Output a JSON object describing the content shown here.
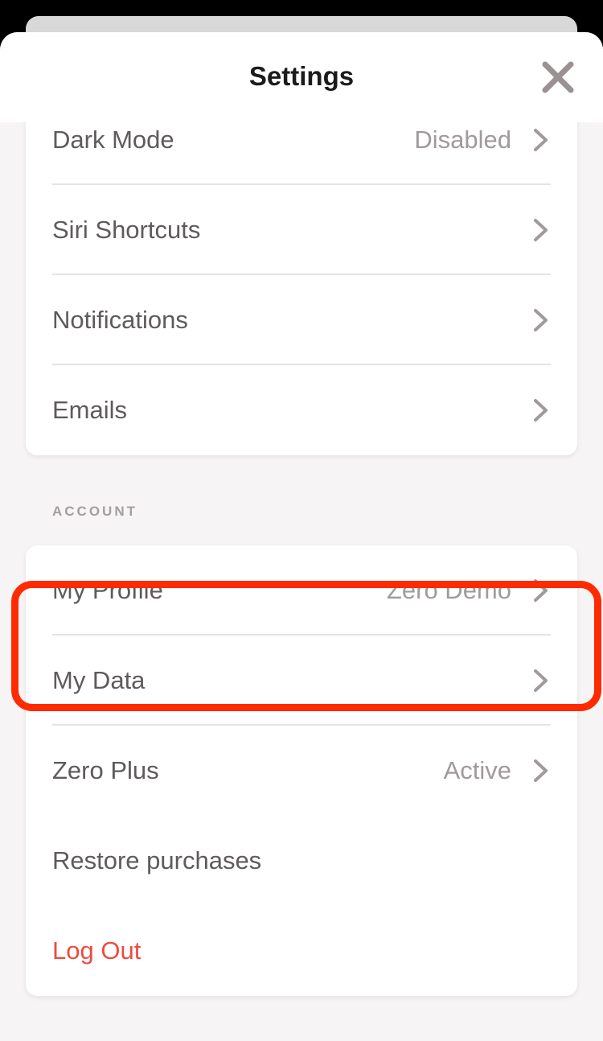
{
  "header": {
    "title": "Settings",
    "close_icon": "close-icon"
  },
  "preferences": {
    "items": [
      {
        "label": "Dark Mode",
        "value": "Disabled"
      },
      {
        "label": "Siri Shortcuts",
        "value": ""
      },
      {
        "label": "Notifications",
        "value": ""
      },
      {
        "label": "Emails",
        "value": ""
      }
    ]
  },
  "account": {
    "section_title": "ACCOUNT",
    "items": [
      {
        "label": "My Profile",
        "value": "Zero Demo"
      },
      {
        "label": "My Data",
        "value": ""
      },
      {
        "label": "Zero Plus",
        "value": "Active"
      },
      {
        "label": "Restore purchases"
      },
      {
        "label": "Log Out"
      }
    ]
  },
  "colors": {
    "highlight": "#ff2a00",
    "danger": "#ef4b3f",
    "text": "#5f5a5b",
    "muted": "#a09a9b",
    "background": "#f6f4f4"
  }
}
